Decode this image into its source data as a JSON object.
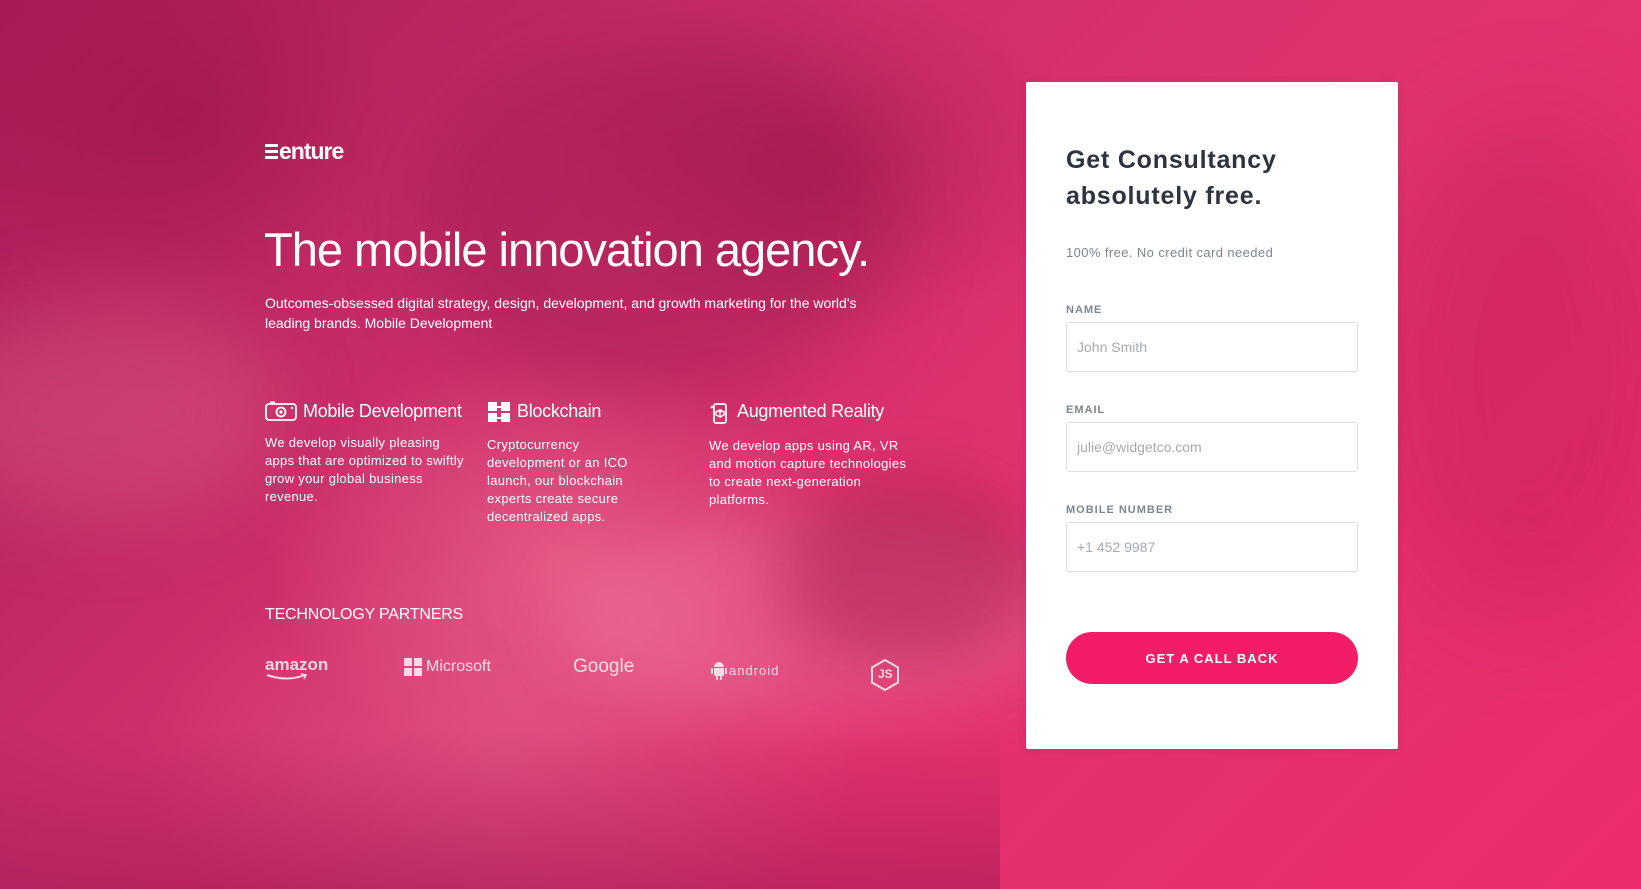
{
  "brand": {
    "logo_text": "enture"
  },
  "hero": {
    "headline": "The mobile innovation agency.",
    "subline": "Outcomes-obsessed digital strategy, design, development, and growth marketing for the world's leading brands. Mobile Development"
  },
  "features": [
    {
      "icon": "mobile-development-icon",
      "title": "Mobile Development",
      "description": "We develop visually pleasing apps that are optimized to swiftly grow your global business revenue."
    },
    {
      "icon": "blockchain-icon",
      "title": "Blockchain",
      "description": "Cryptocurrency development or an ICO launch, our blockchain experts create secure decentralized apps."
    },
    {
      "icon": "augmented-reality-icon",
      "title": "Augmented Reality",
      "description": "We develop apps using AR, VR and motion capture technologies to create next-generation platforms."
    }
  ],
  "partners": {
    "title": "TECHNOLOGY PARTNERS",
    "items": [
      "amazon",
      "Microsoft",
      "Google",
      "android",
      "JS"
    ]
  },
  "form": {
    "title": "Get Consultancy absolutely free.",
    "subtitle": "100% free. No credit card needed",
    "name_label": "NAME",
    "name_placeholder": "John Smith",
    "email_label": "EMAIL",
    "email_placeholder": "julie@widgetco.com",
    "mobile_label": "MOBILE NUMBER",
    "mobile_placeholder": "+1 452 9987",
    "submit_label": "GET A CALL BACK"
  },
  "colors": {
    "background_overlay": "#d4306c",
    "cta_button": "#f31c68",
    "card_background": "#ffffff",
    "heading_text": "#2d3340"
  }
}
